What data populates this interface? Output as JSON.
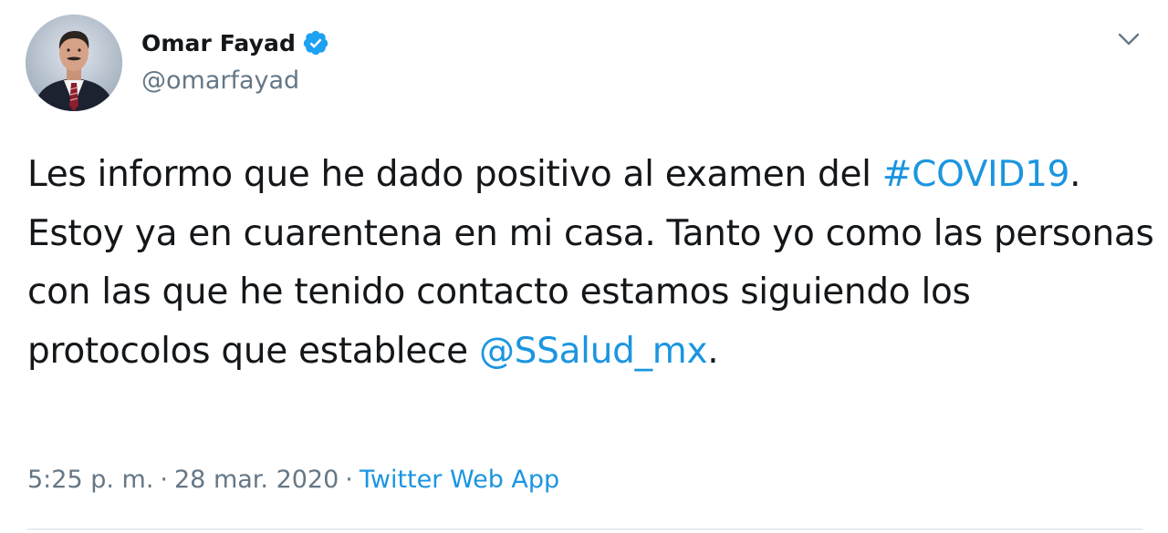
{
  "tweet": {
    "author": {
      "name": "Omar Fayad",
      "handle": "@omarfayad",
      "verified_icon": "verified-badge-icon",
      "avatar": "profile-photo"
    },
    "menu_icon": "chevron-down-icon",
    "text": {
      "part1": "Les informo que he dado positivo al examen del ",
      "hashtag": "#COVID19",
      "part2": ". Estoy ya en cuarentena en mi casa. Tanto yo como las personas con las que he tenido contacto estamos siguiendo los protocolos que establece ",
      "mention": "@SSalud_mx",
      "part3": "."
    },
    "meta": {
      "time": "5:25 p. m.",
      "separator": "·",
      "date": "28 mar. 2020",
      "source": "Twitter Web App"
    },
    "colors": {
      "link": "#1b95e0",
      "secondary_text": "#657786",
      "primary_text": "#14171a",
      "verified": "#1da1f2"
    }
  }
}
